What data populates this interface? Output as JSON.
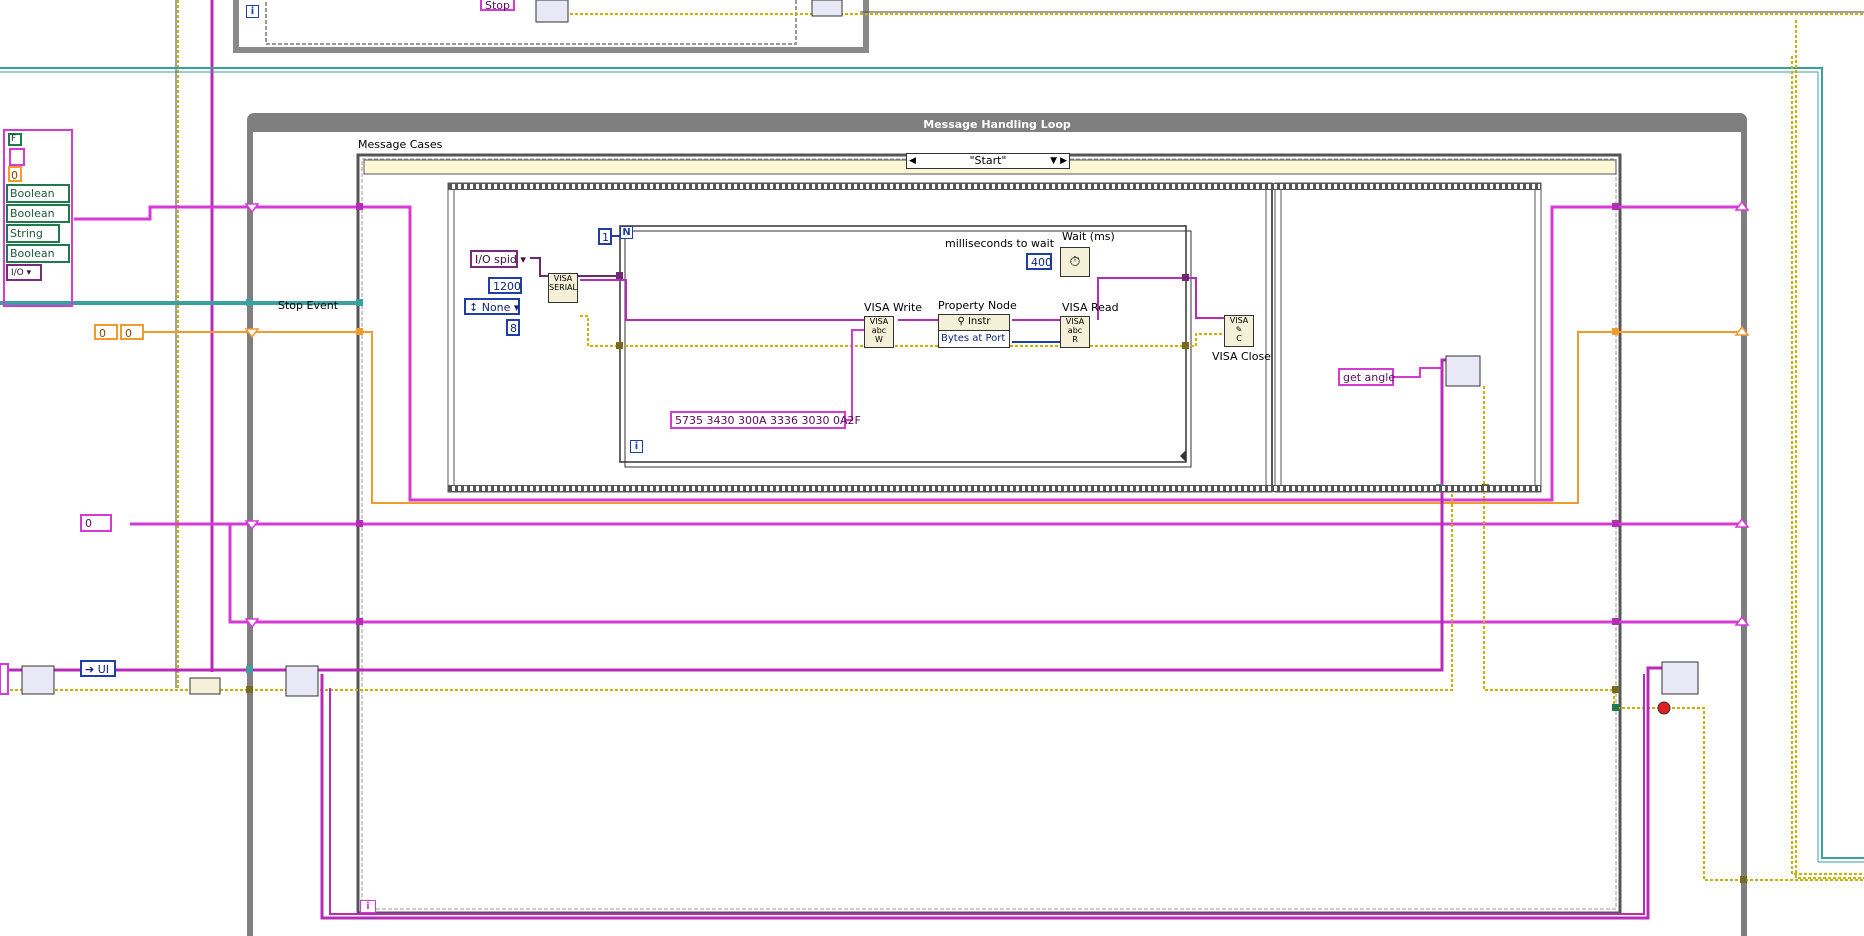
{
  "window": {
    "title": "LabVIEW Block Diagram",
    "background": "#ffffff"
  },
  "colors": {
    "string_wire": "#d63ad6",
    "numeric_wire": "#f19a2e",
    "refnum_wire": "#6e2a6e",
    "error_wire": "#c8b400",
    "boolean_wire": "#1e7a4a",
    "event_wire": "#3aa0a0",
    "structure_frame": "#7f7f7f",
    "int_constant": "#1f3fa6"
  },
  "top_loop": {
    "stop_label": "Stop",
    "iteration_label": "i"
  },
  "message_loop": {
    "title": "Message Handling Loop",
    "iteration_label": "i"
  },
  "case_structure": {
    "label": "Message Cases",
    "selector_value": "\"Start\"",
    "default_marker": "Def"
  },
  "cluster_constant": {
    "header": "F",
    "numeric": "0",
    "items": [
      "Boolean",
      "Boolean",
      "String",
      "Boolean"
    ],
    "enum_icon": "I/O"
  },
  "left_constants": {
    "numeric_pair": [
      "0",
      "0"
    ],
    "numeric_single": "0",
    "stop_event": "Stop Event",
    "ui_label": "UI"
  },
  "inner_frame": {
    "com_port": "spid",
    "baud_rate": "1200",
    "parity": "None",
    "data_bits": "8",
    "loop_count": "1",
    "count_terminal": "N",
    "iteration_label": "i",
    "ms_to_wait_label": "milliseconds to wait",
    "wait_label": "Wait (ms)",
    "wait_value": "400",
    "visa_write_label": "VISA Write",
    "property_node_label": "Property Node",
    "property_class": "Instr",
    "property_name": "Bytes at Port",
    "visa_read_label": "VISA Read",
    "visa_close_label": "VISA Close",
    "write_buffer": "5735 3430 300A 3336 3030 0A2F",
    "serial_node_text": "VISA SERIAL"
  },
  "second_frame": {
    "message_constant": "get angle"
  }
}
